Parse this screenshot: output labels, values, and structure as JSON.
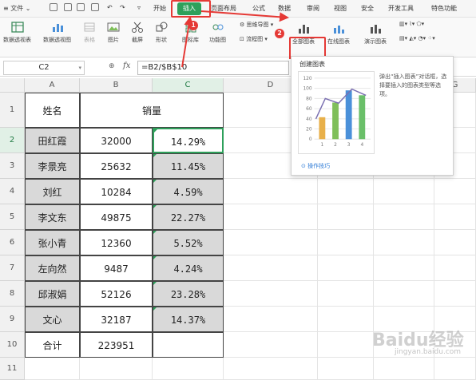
{
  "menubar": {
    "file": "文件",
    "tabs": [
      "开始",
      "插入",
      "页面布局",
      "公式",
      "数据",
      "审阅",
      "视图",
      "安全",
      "开发工具",
      "特色功能"
    ],
    "active_tab": "插入"
  },
  "ribbon": {
    "items": [
      "数据透视表",
      "数据透视图",
      "表格",
      "图片",
      "截屏",
      "形状",
      "图标库",
      "功能图",
      "思维导图",
      "流程图",
      "全部图表",
      "在线图表",
      "演示图表"
    ]
  },
  "formula_bar": {
    "cell_ref": "C2",
    "formula": "=B2/$B$10",
    "fx": "fx"
  },
  "columns": [
    "A",
    "B",
    "C",
    "D",
    "E",
    "F",
    "G"
  ],
  "rows": [
    "1",
    "2",
    "3",
    "4",
    "5",
    "6",
    "7",
    "8",
    "9",
    "10",
    "11"
  ],
  "table": {
    "header_name": "姓名",
    "header_sales": "销量",
    "records": [
      {
        "name": "田红霞",
        "sales": "32000",
        "pct": "14.29%"
      },
      {
        "name": "李景亮",
        "sales": "25632",
        "pct": "11.45%"
      },
      {
        "name": "刘红",
        "sales": "10284",
        "pct": "4.59%"
      },
      {
        "name": "李文东",
        "sales": "49875",
        "pct": "22.27%"
      },
      {
        "name": "张小青",
        "sales": "12360",
        "pct": "5.52%"
      },
      {
        "name": "左向然",
        "sales": "9487",
        "pct": "4.24%"
      },
      {
        "name": "邱淑娟",
        "sales": "52126",
        "pct": "23.28%"
      },
      {
        "name": "文心",
        "sales": "32187",
        "pct": "14.37%"
      }
    ],
    "total_label": "合计",
    "total_value": "223951"
  },
  "tooltip": {
    "title": "创建图表",
    "description": "弹出“插入图表”对话框，选择要插入的图表类型等选项。",
    "help": "操作技巧",
    "y_ticks": [
      "120",
      "100",
      "80",
      "60",
      "40",
      "20",
      "0"
    ],
    "x_ticks": [
      "1",
      "2",
      "3",
      "4"
    ],
    "bar_colors": [
      "#e8b04a",
      "#7fbf5a",
      "#4a90d9",
      "#6abf69"
    ]
  },
  "annotations": {
    "step1": "1",
    "step2": "2"
  },
  "watermark": {
    "main": "Baidu经验",
    "sub": "jingyan.baidu.com"
  }
}
